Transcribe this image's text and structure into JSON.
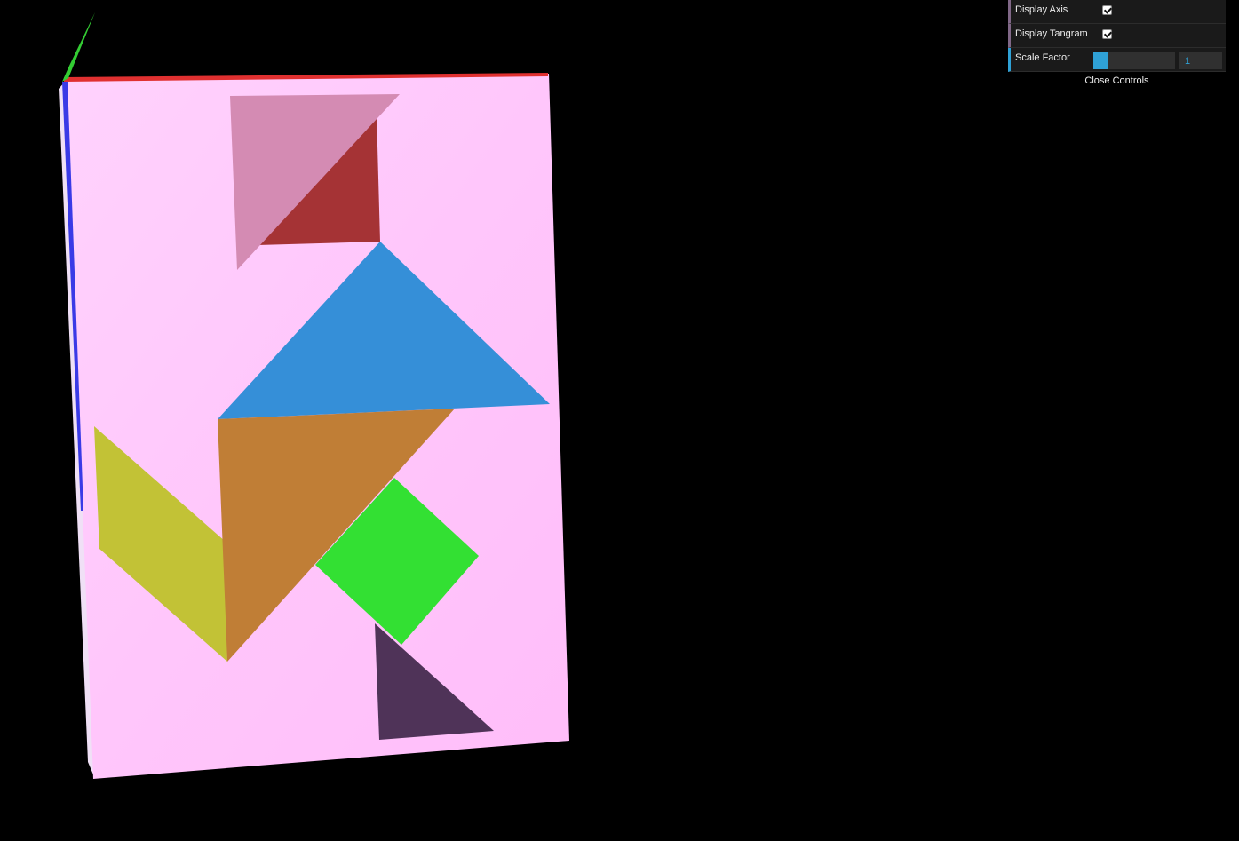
{
  "scene": {
    "board_color": "#ffc2fb",
    "axis_colors": {
      "x": "#e03030",
      "y": "#33cc33",
      "z": "#3a3ae6"
    },
    "pieces": [
      {
        "name": "pink-triangle",
        "color": "#d48bb3"
      },
      {
        "name": "red-triangle",
        "color": "#a53335"
      },
      {
        "name": "blue-triangle",
        "color": "#358fd8"
      },
      {
        "name": "orange-triangle",
        "color": "#c07e36"
      },
      {
        "name": "yellow-parallelogram",
        "color": "#c2c236"
      },
      {
        "name": "green-square",
        "color": "#33e033"
      },
      {
        "name": "purple-triangle",
        "color": "#4f3358"
      }
    ]
  },
  "controls": {
    "display_axis": {
      "label": "Display Axis",
      "checked": true
    },
    "display_tangram": {
      "label": "Display Tangram",
      "checked": true
    },
    "scale_factor": {
      "label": "Scale Factor",
      "value": "1",
      "fill_fraction": 0.19
    },
    "close_label": "Close Controls",
    "accent_color": "#2fa1d6",
    "bool_accent_color": "#806787"
  }
}
